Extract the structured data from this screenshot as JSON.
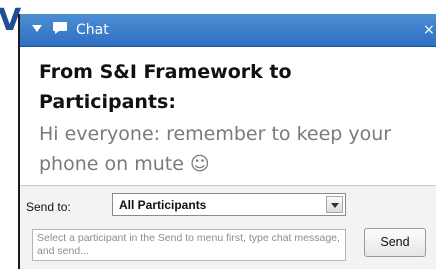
{
  "background_letter": "V",
  "chat": {
    "title": "Chat",
    "close_glyph": "×",
    "icons": {
      "collapse": "collapse-arrow-icon",
      "chat": "chat-bubble-icon",
      "close": "close-icon"
    },
    "message": {
      "sender_line": "From S&I Framework to Participants:",
      "body": "Hi everyone: remember to keep your phone on mute ☺"
    },
    "compose": {
      "send_to_label": "Send to:",
      "send_to_value": "All Participants",
      "input_placeholder": "Select a participant in the Send to menu first, type chat message, and send...",
      "send_button_label": "Send"
    }
  },
  "colors": {
    "titlebar": "#3d7fcb",
    "accent_text": "#1f4e94"
  }
}
